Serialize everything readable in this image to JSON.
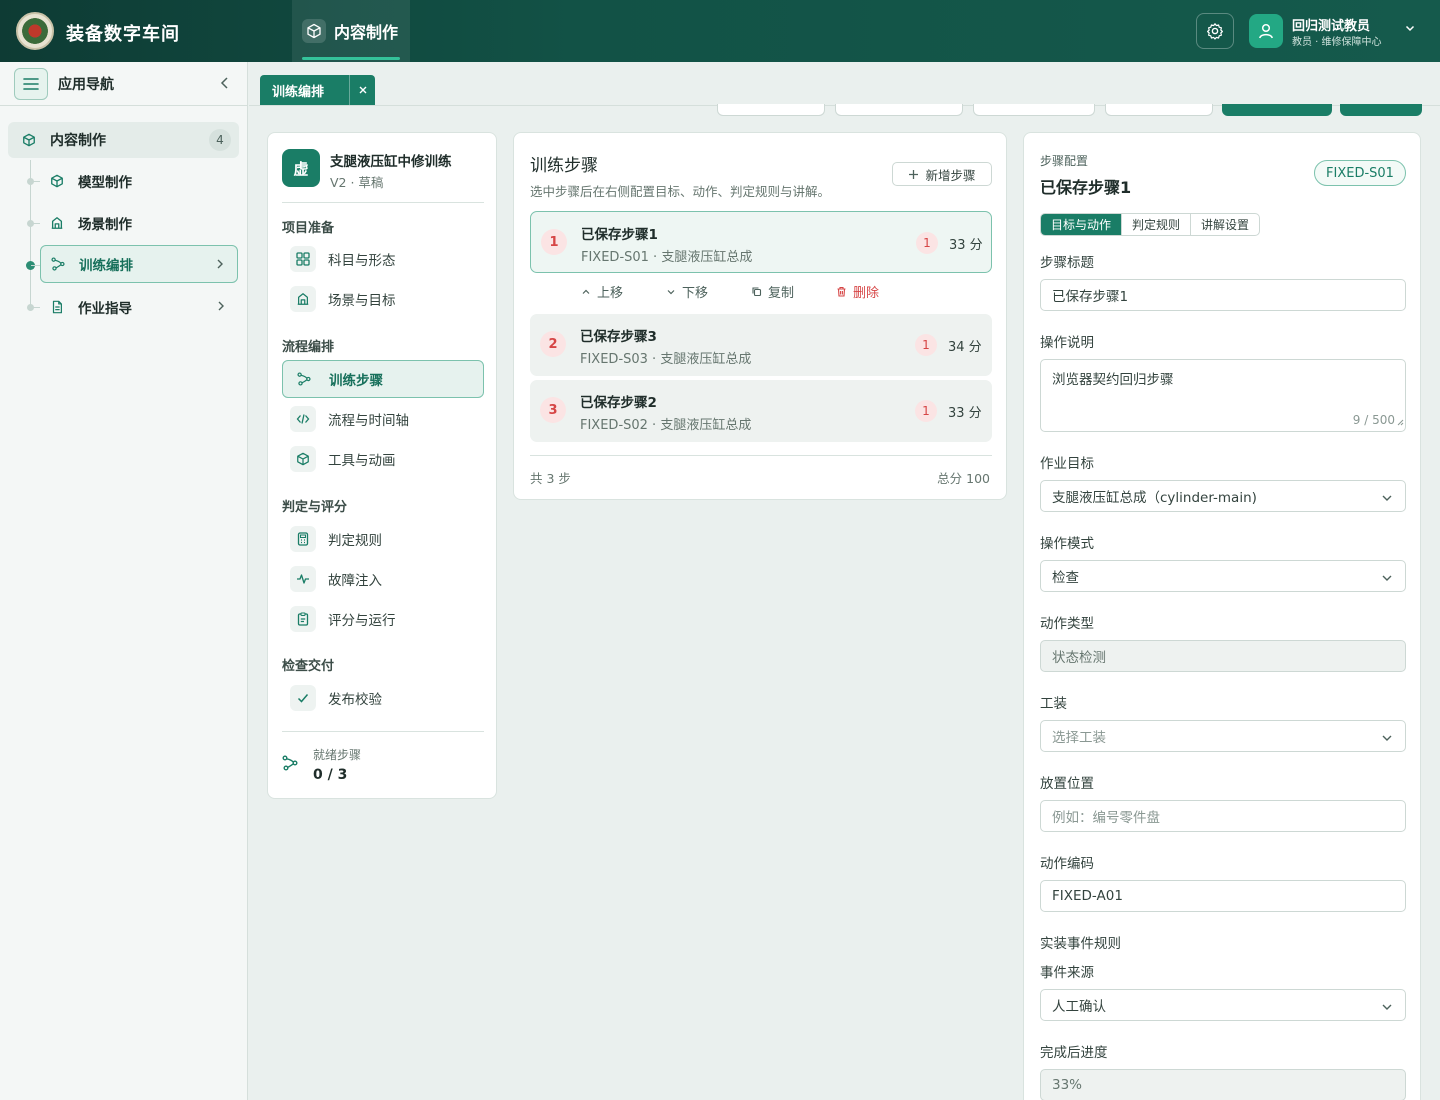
{
  "header": {
    "app_title": "装备数字车间",
    "active_tab": "内容制作",
    "user_name": "回归测试教员",
    "user_role": "教员 · 维修保障中心"
  },
  "sidebar": {
    "title": "应用导航",
    "group": {
      "label": "内容制作",
      "count": "4"
    },
    "items": [
      {
        "label": "模型制作"
      },
      {
        "label": "场景制作"
      },
      {
        "label": "训练编排"
      },
      {
        "label": "作业指导"
      }
    ]
  },
  "tabs": {
    "active_label": "训练编排"
  },
  "project": {
    "icon_char": "虚",
    "title": "支腿液压缸中修训练",
    "subtitle": "V2 · 草稿",
    "sections": [
      {
        "title": "项目准备",
        "items": [
          "科目与形态",
          "场景与目标"
        ]
      },
      {
        "title": "流程编排",
        "items": [
          "训练步骤",
          "流程与时间轴",
          "工具与动画"
        ]
      },
      {
        "title": "判定与评分",
        "items": [
          "判定规则",
          "故障注入",
          "评分与运行"
        ]
      },
      {
        "title": "检查交付",
        "items": [
          "发布校验"
        ]
      }
    ],
    "ready_label": "就绪步骤",
    "ready_value": "0 / 3"
  },
  "steps": {
    "title": "训练步骤",
    "subtitle": "选中步骤后在右侧配置目标、动作、判定规则与讲解。",
    "add_label": "新增步骤",
    "cards": [
      {
        "num": "1",
        "title": "已保存步骤1",
        "sub": "FIXED-S01 · 支腿液压缸总成",
        "badge": "1",
        "score": "33 分"
      },
      {
        "num": "2",
        "title": "已保存步骤3",
        "sub": "FIXED-S03 · 支腿液压缸总成",
        "badge": "1",
        "score": "34 分"
      },
      {
        "num": "3",
        "title": "已保存步骤2",
        "sub": "FIXED-S02 · 支腿液压缸总成",
        "badge": "1",
        "score": "33 分"
      }
    ],
    "ops": {
      "up": "上移",
      "down": "下移",
      "copy": "复制",
      "delete": "删除"
    },
    "total_steps": "共 3 步",
    "total_score": "总分 100"
  },
  "config": {
    "kicker": "步骤配置",
    "title": "已保存步骤1",
    "code": "FIXED-S01",
    "tabs": [
      "目标与动作",
      "判定规则",
      "讲解设置"
    ],
    "step_title_label": "步骤标题",
    "step_title_value": "已保存步骤1",
    "desc_label": "操作说明",
    "desc_value": "浏览器契约回归步骤",
    "desc_count": "9 / 500",
    "target_label": "作业目标",
    "target_value": "支腿液压缸总成（cylinder-main)",
    "mode_label": "操作模式",
    "mode_value": "检查",
    "action_type_label": "动作类型",
    "action_type_value": "状态检测",
    "tool_label": "工装",
    "tool_value": "选择工装",
    "place_label": "放置位置",
    "place_placeholder": "例如：编号零件盘",
    "action_code_label": "动作编码",
    "action_code_value": "FIXED-A01",
    "event_rules_label": "实装事件规则",
    "event_source_label": "事件来源",
    "event_source_value": "人工确认",
    "progress_label": "完成后进度",
    "progress_value": "33%"
  },
  "colors": {
    "primary": "#1a7d66",
    "header": "#125246",
    "danger": "#d64545"
  }
}
